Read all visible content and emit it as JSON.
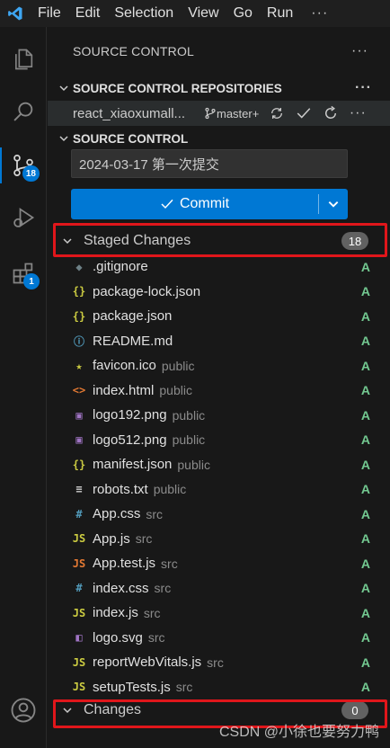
{
  "menubar": {
    "items": [
      "File",
      "Edit",
      "Selection",
      "View",
      "Go",
      "Run"
    ],
    "more": "···"
  },
  "activitybar": {
    "scm_badge": "18",
    "extensions_badge": "1"
  },
  "sidebar": {
    "title": "SOURCE CONTROL",
    "more": "···"
  },
  "repositories": {
    "header": "SOURCE CONTROL REPOSITORIES",
    "repo_name": "react_xiaoxumall...",
    "branch": "master+"
  },
  "scm": {
    "header": "SOURCE CONTROL",
    "message_value": "2024-03-17 第一次提交",
    "commit_label": "Commit"
  },
  "staged": {
    "label": "Staged Changes",
    "count": "18",
    "files": [
      {
        "name": ".gitignore",
        "dir": "",
        "status": "A",
        "icon": "git-icon",
        "glyph": "◆",
        "color": "#6d8086"
      },
      {
        "name": "package-lock.json",
        "dir": "",
        "status": "A",
        "icon": "json-icon",
        "glyph": "{}",
        "color": "#cbcb41"
      },
      {
        "name": "package.json",
        "dir": "",
        "status": "A",
        "icon": "json-icon",
        "glyph": "{}",
        "color": "#cbcb41"
      },
      {
        "name": "README.md",
        "dir": "",
        "status": "A",
        "icon": "info-icon",
        "glyph": "ⓘ",
        "color": "#519aba"
      },
      {
        "name": "favicon.ico",
        "dir": "public",
        "status": "A",
        "icon": "star-icon",
        "glyph": "★",
        "color": "#cbcb41"
      },
      {
        "name": "index.html",
        "dir": "public",
        "status": "A",
        "icon": "html-icon",
        "glyph": "<>",
        "color": "#e37933"
      },
      {
        "name": "logo192.png",
        "dir": "public",
        "status": "A",
        "icon": "image-icon",
        "glyph": "▣",
        "color": "#a074c4"
      },
      {
        "name": "logo512.png",
        "dir": "public",
        "status": "A",
        "icon": "image-icon",
        "glyph": "▣",
        "color": "#a074c4"
      },
      {
        "name": "manifest.json",
        "dir": "public",
        "status": "A",
        "icon": "json-icon",
        "glyph": "{}",
        "color": "#cbcb41"
      },
      {
        "name": "robots.txt",
        "dir": "public",
        "status": "A",
        "icon": "text-icon",
        "glyph": "≡",
        "color": "#cccccc"
      },
      {
        "name": "App.css",
        "dir": "src",
        "status": "A",
        "icon": "css-icon",
        "glyph": "#",
        "color": "#519aba"
      },
      {
        "name": "App.js",
        "dir": "src",
        "status": "A",
        "icon": "js-icon",
        "glyph": "JS",
        "color": "#cbcb41"
      },
      {
        "name": "App.test.js",
        "dir": "src",
        "status": "A",
        "icon": "js-test-icon",
        "glyph": "JS",
        "color": "#e37933"
      },
      {
        "name": "index.css",
        "dir": "src",
        "status": "A",
        "icon": "css-icon",
        "glyph": "#",
        "color": "#519aba"
      },
      {
        "name": "index.js",
        "dir": "src",
        "status": "A",
        "icon": "js-icon",
        "glyph": "JS",
        "color": "#cbcb41"
      },
      {
        "name": "logo.svg",
        "dir": "src",
        "status": "A",
        "icon": "svg-icon",
        "glyph": "◧",
        "color": "#a074c4"
      },
      {
        "name": "reportWebVitals.js",
        "dir": "src",
        "status": "A",
        "icon": "js-icon",
        "glyph": "JS",
        "color": "#cbcb41"
      },
      {
        "name": "setupTests.js",
        "dir": "src",
        "status": "A",
        "icon": "js-icon",
        "glyph": "JS",
        "color": "#cbcb41"
      }
    ]
  },
  "changes": {
    "label": "Changes",
    "count": "0"
  },
  "watermark": "CSDN @小徐也要努力鸭",
  "colors": {
    "accent": "#0078d4",
    "added": "#73c991",
    "highlight": "#e0161b"
  }
}
